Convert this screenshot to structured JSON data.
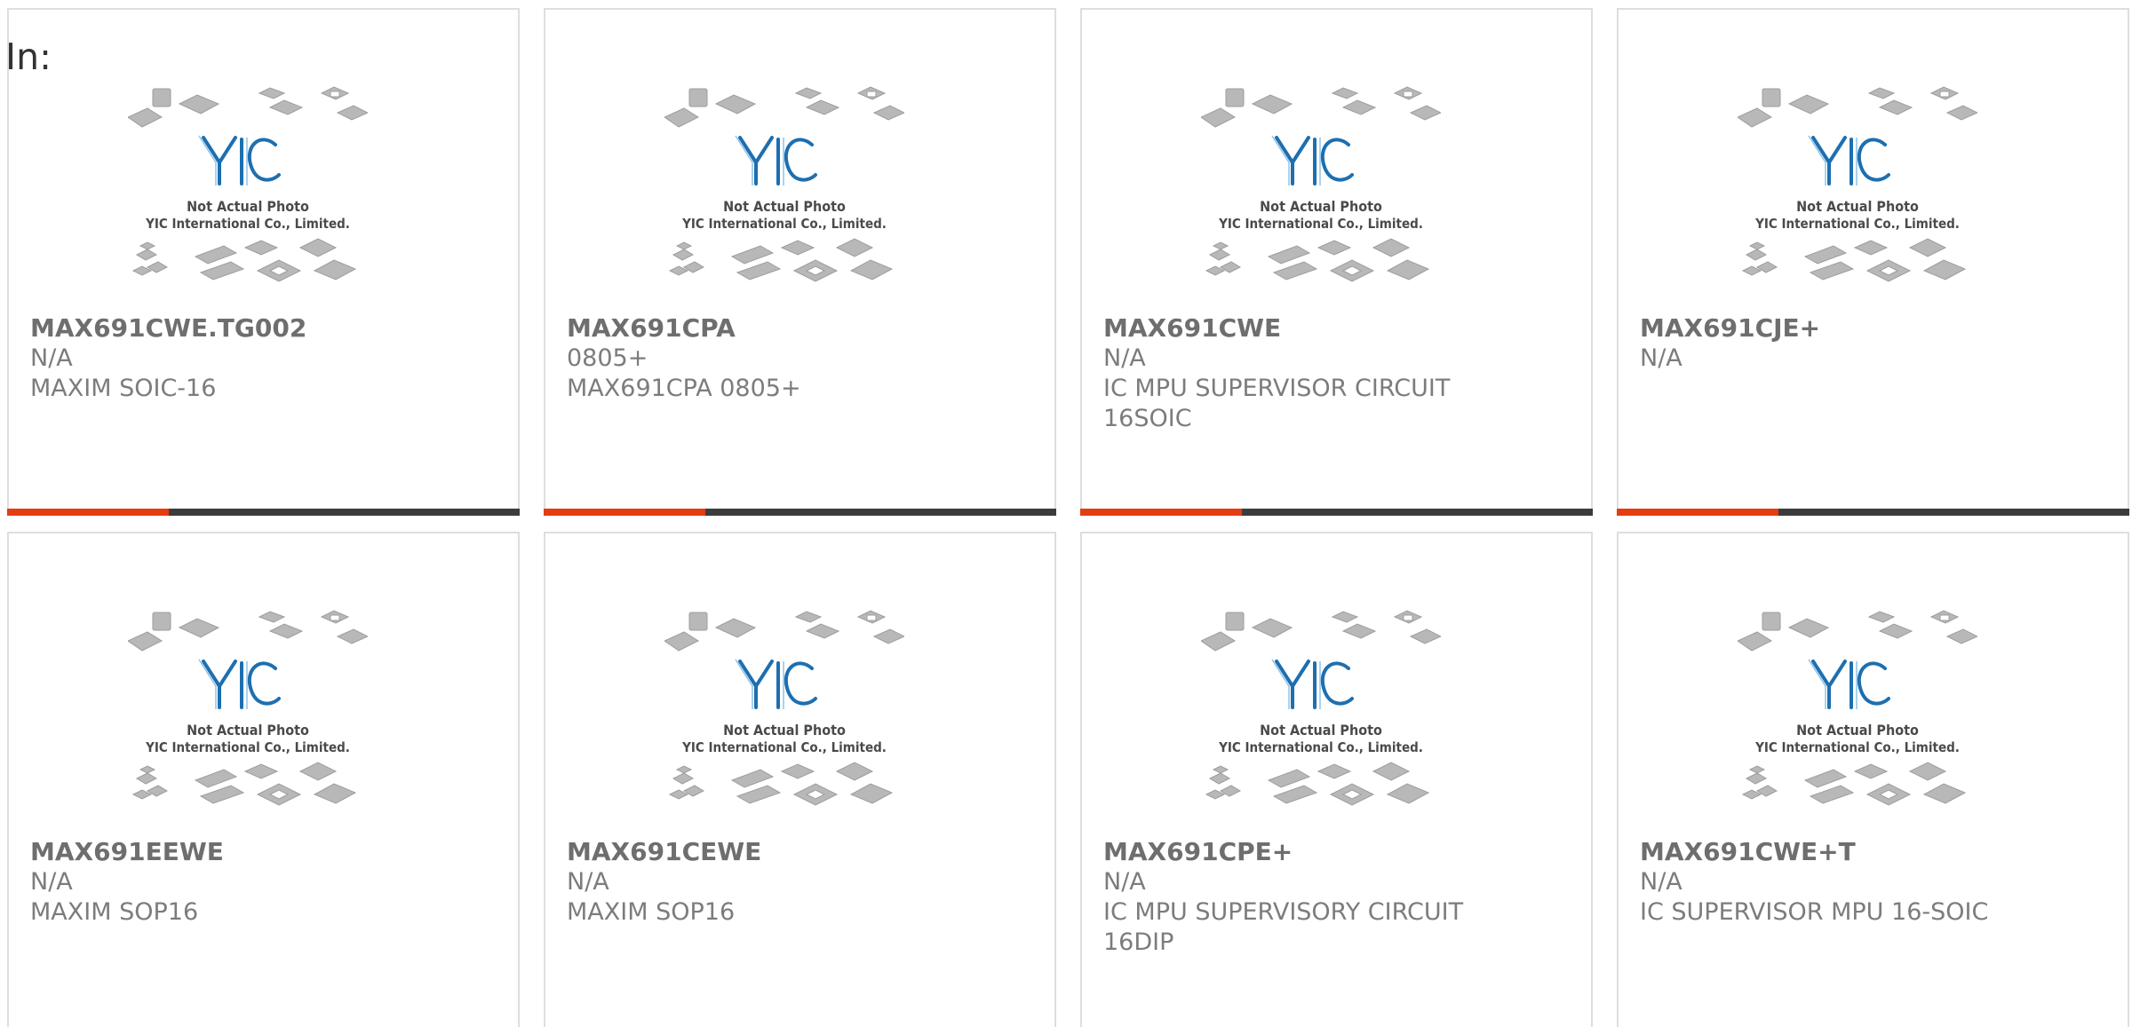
{
  "header": {
    "in_label": "In:"
  },
  "placeholder_image": {
    "line1": "Not Actual Photo",
    "line2": "YIC International Co., Limited.",
    "logo_text": "YIC"
  },
  "colors": {
    "accent": "#e43d12",
    "bar": "#3c3c3c",
    "logo_blue": "#1d6fb0"
  },
  "products": [
    {
      "part": "MAX691CWE.TG002",
      "sub": "N/A",
      "desc": "MAXIM SOIC-16"
    },
    {
      "part": "MAX691CPA",
      "sub": "0805+",
      "desc": "MAX691CPA 0805+"
    },
    {
      "part": "MAX691CWE",
      "sub": "N/A",
      "desc": "IC MPU SUPERVISOR CIRCUIT 16SOIC"
    },
    {
      "part": "MAX691CJE+",
      "sub": "N/A",
      "desc": ""
    },
    {
      "part": "MAX691EEWE",
      "sub": "N/A",
      "desc": "MAXIM SOP16"
    },
    {
      "part": "MAX691CEWE",
      "sub": "N/A",
      "desc": "MAXIM SOP16"
    },
    {
      "part": "MAX691CPE+",
      "sub": "N/A",
      "desc": "IC MPU SUPERVISORY CIRCUIT 16DIP"
    },
    {
      "part": "MAX691CWE+T",
      "sub": "N/A",
      "desc": "IC SUPERVISOR MPU 16-SOIC"
    }
  ]
}
